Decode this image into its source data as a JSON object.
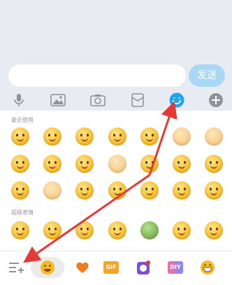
{
  "input": {
    "placeholder": ""
  },
  "send_button_label": "发送",
  "toolbar": [
    "voice-icon",
    "image-icon",
    "camera-icon",
    "red-packet-icon",
    "emoji-icon",
    "add-icon"
  ],
  "sections": {
    "recent": "最近使用",
    "super": "超级表情"
  },
  "colors": {
    "accent_blue": "#1ea5f2",
    "annotation_red": "#e53935",
    "send_bg": "#a9d8f5"
  },
  "bottom_tabs": [
    "menu-add-icon",
    "emoji-tab",
    "heart-tab",
    "gif-tab",
    "sticker-tab",
    "diy-tab",
    "grin-tab"
  ],
  "bottom_labels": {
    "gif": "GIF",
    "diy": "DIY"
  }
}
